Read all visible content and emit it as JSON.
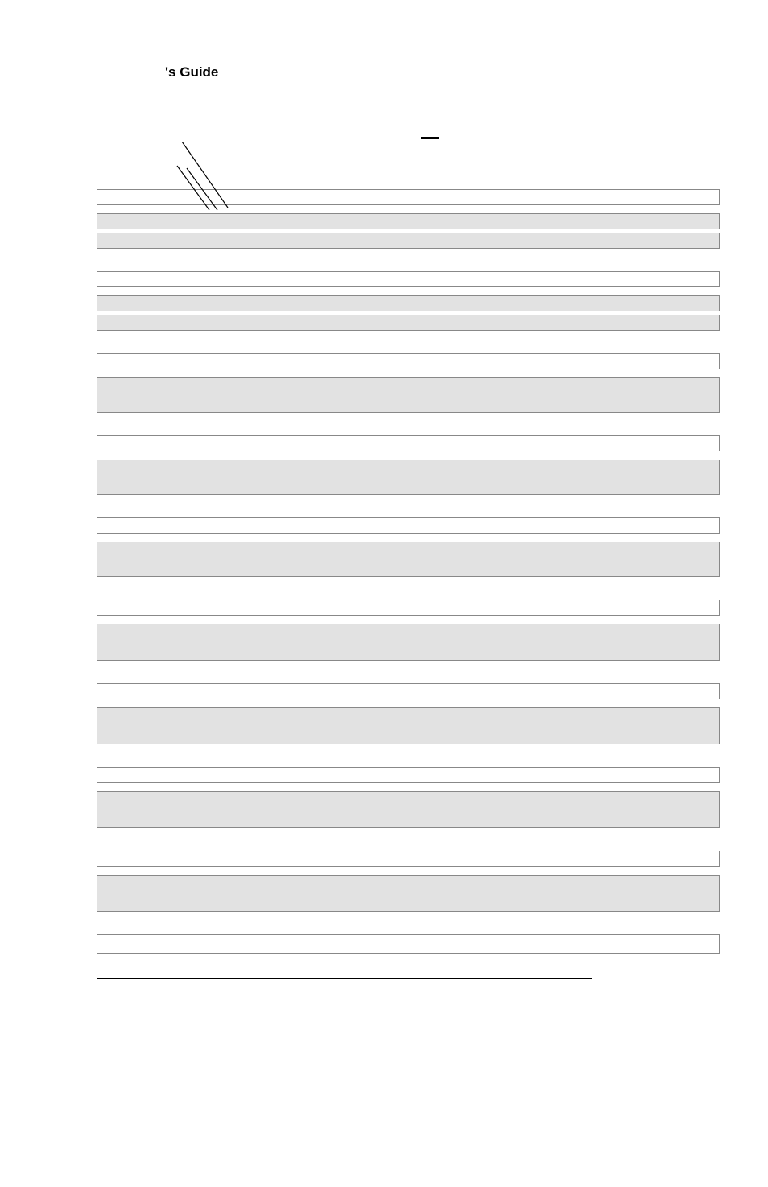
{
  "header": {
    "title_suffix": "'s Guide"
  },
  "sections": [
    {
      "top_height": "h20",
      "bottom_height": "h20",
      "extra_shaded": true
    },
    {
      "top_height": "h20",
      "bottom_height": "h20",
      "extra_shaded": true
    },
    {
      "top_height": "h20",
      "bottom_height": "h44",
      "extra_shaded": false
    },
    {
      "top_height": "h20",
      "bottom_height": "h44",
      "extra_shaded": false
    },
    {
      "top_height": "h20",
      "bottom_height": "h44",
      "extra_shaded": false
    },
    {
      "top_height": "h20",
      "bottom_height": "h46",
      "extra_shaded": false
    },
    {
      "top_height": "h20",
      "bottom_height": "h46",
      "extra_shaded": false
    },
    {
      "top_height": "h20",
      "bottom_height": "h46",
      "extra_shaded": false
    },
    {
      "top_height": "h20",
      "bottom_height": "h46",
      "extra_shaded": false
    }
  ],
  "last_row": {
    "height": "h24"
  }
}
